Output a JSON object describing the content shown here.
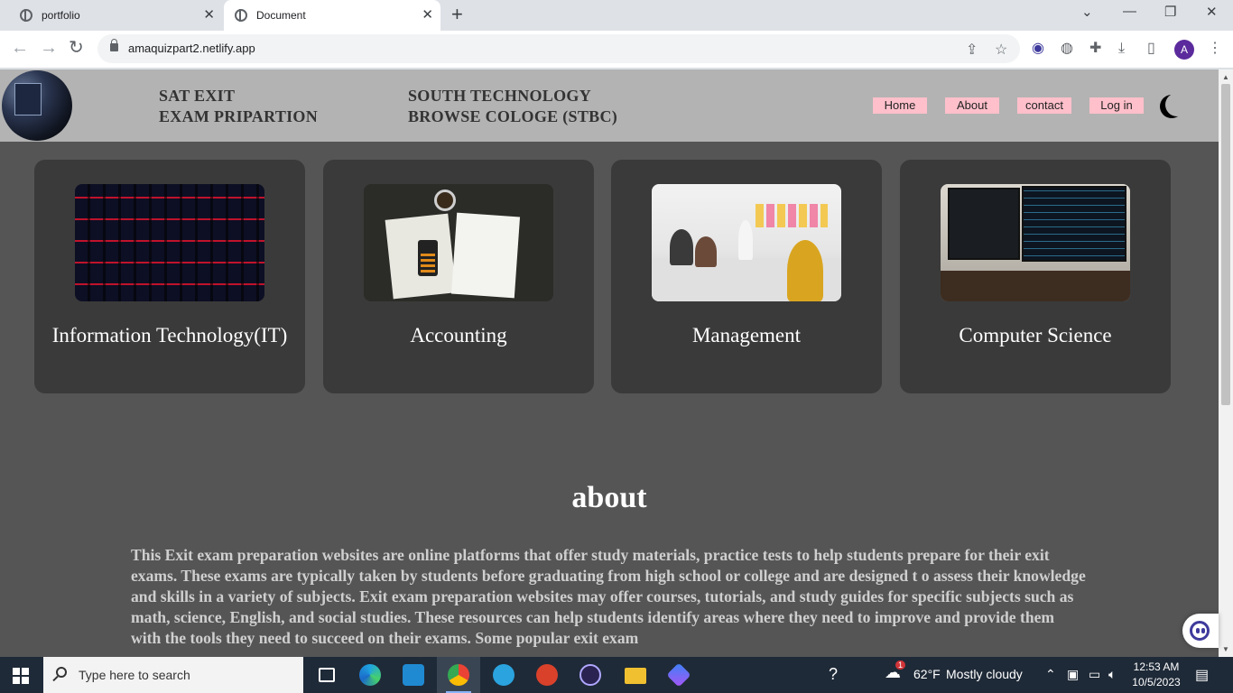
{
  "browser": {
    "tabs": [
      {
        "title": "portfolio",
        "active": false
      },
      {
        "title": "Document",
        "active": true
      }
    ],
    "url": "amaquizpart2.netlify.app",
    "profile_initial": "A"
  },
  "site": {
    "brand_left": [
      "SAT EXIT",
      "EXAM PRIPARTION"
    ],
    "brand_right": [
      "SOUTH TECHNOLOGY",
      "BROWSE COLOGE (STBC)"
    ],
    "nav": [
      "Home",
      "About",
      "contact",
      "Log in"
    ],
    "colors": {
      "header_bg": "#b3b3b3",
      "page_bg": "#555555",
      "card_bg": "#3a3a3a",
      "nav_bg": "#ffc0cb"
    },
    "cards": [
      {
        "title": "Information Technology(IT)",
        "image": "red-backlit-keyboard"
      },
      {
        "title": "Accounting",
        "image": "calculator-and-papers"
      },
      {
        "title": "Management",
        "image": "team-meeting-sticky-notes"
      },
      {
        "title": "Computer Science",
        "image": "dual-monitor-code-setup"
      }
    ],
    "about": {
      "title": "about",
      "text": "This Exit exam preparation websites are online platforms that offer study materials, practice tests to help students prepare for their exit exams. These exams are typically taken by students before graduating from high school or college and are designed t o assess their knowledge and skills in a variety of subjects. Exit exam preparation websites may offer courses, tutorials, and study guides for specific subjects such as math, science, English, and social studies. These resources can help students identify areas where they need to improve and provide them with the tools they need to succeed on their exams. Some popular exit exam"
    }
  },
  "taskbar": {
    "search_placeholder": "Type here to search",
    "weather": {
      "temp": "62°F",
      "condition": "Mostly cloudy",
      "badge": "1"
    },
    "time": "12:53 AM",
    "date": "10/5/2023"
  }
}
